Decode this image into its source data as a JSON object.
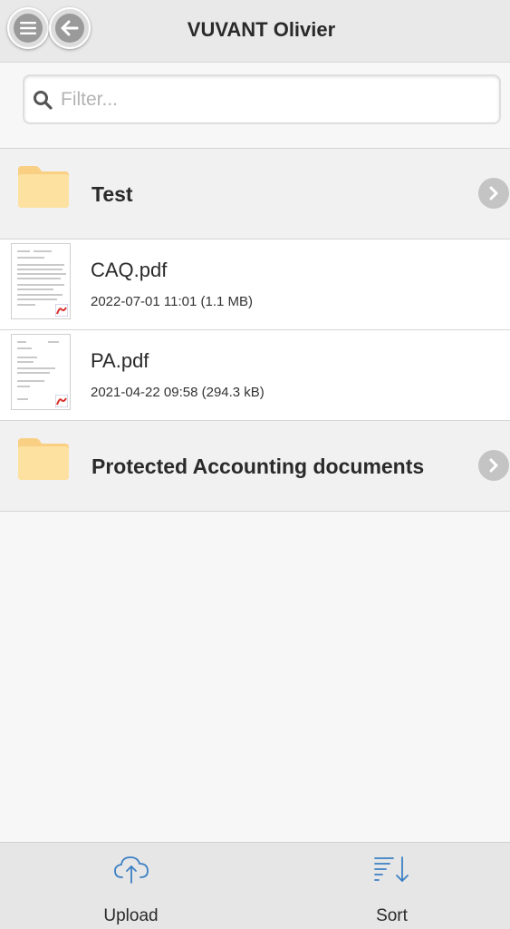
{
  "header": {
    "title": "VUVANT Olivier",
    "menu_icon": "menu-icon",
    "back_icon": "back-arrow-icon"
  },
  "filter": {
    "placeholder": "Filter...",
    "value": "",
    "icon": "search-icon"
  },
  "items": [
    {
      "type": "folder",
      "name": "Test",
      "icon": "folder-icon"
    },
    {
      "type": "file",
      "name": "CAQ.pdf",
      "meta": "2022-07-01 11:01 (1.1 MB)",
      "icon": "pdf-thumbnail"
    },
    {
      "type": "file",
      "name": "PA.pdf",
      "meta": "2021-04-22 09:58 (294.3 kB)",
      "icon": "pdf-thumbnail"
    },
    {
      "type": "folder",
      "name": "Protected Accounting documents",
      "icon": "folder-icon"
    }
  ],
  "footer": {
    "upload_label": "Upload",
    "upload_icon": "cloud-upload-icon",
    "sort_label": "Sort",
    "sort_icon": "sort-icon"
  },
  "colors": {
    "header_bg": "#e9e9e9",
    "folder_fill": "#fbd98e",
    "accent_blue": "#3b7fc4",
    "chevron_bg": "#c4c4c4"
  }
}
